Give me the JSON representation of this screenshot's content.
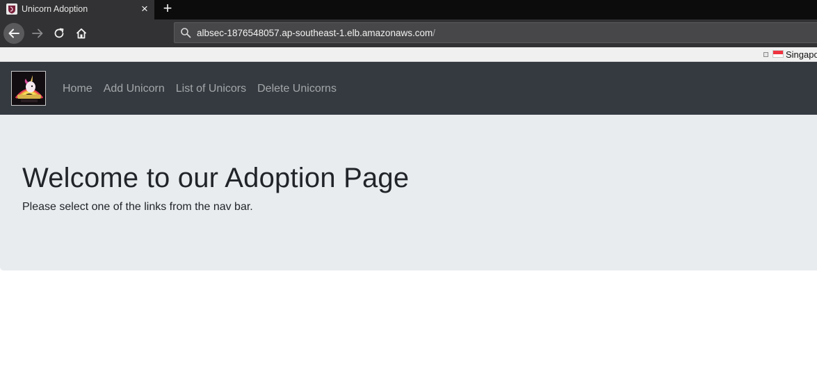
{
  "browser": {
    "tab": {
      "title": "Unicorn Adoption",
      "close_icon": "×"
    },
    "new_tab_icon": "+",
    "url": {
      "main": "albsec-1876548057.ap-southeast-1.elb.amazonaws.com",
      "trailing": "/"
    },
    "bookmarks": [
      {
        "label": "Singapo"
      }
    ]
  },
  "site": {
    "nav": {
      "links": [
        {
          "label": "Home"
        },
        {
          "label": "Add Unicorn"
        },
        {
          "label": "List of Unicors"
        },
        {
          "label": "Delete Unicorns"
        }
      ]
    },
    "jumbotron": {
      "title": "Welcome to our Adoption Page",
      "lead": "Please select one of the links from the nav bar."
    }
  },
  "colors": {
    "nav_bg": "#343a40",
    "jumbotron_bg": "#e9ecef",
    "text": "#212529",
    "nav_link": "rgba(255,255,255,0.55)"
  }
}
